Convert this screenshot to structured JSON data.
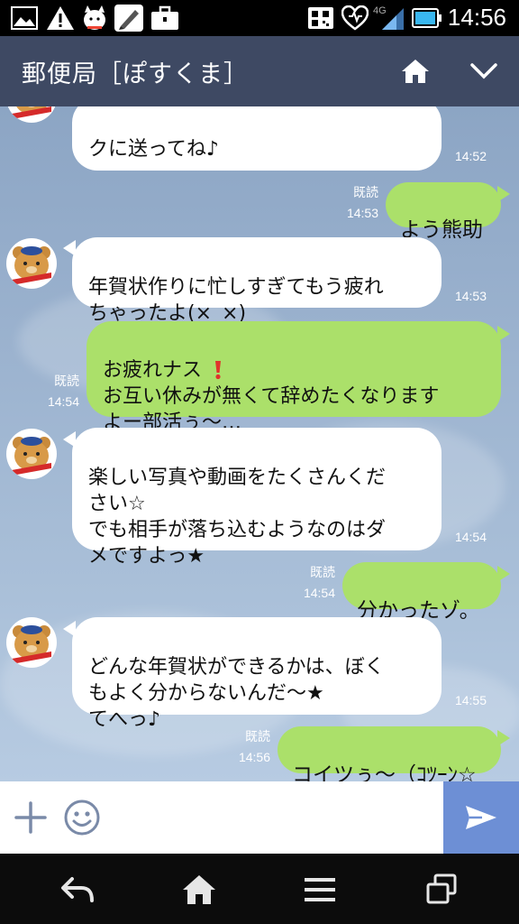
{
  "status_bar": {
    "time": "14:56",
    "network": "4G",
    "icons": [
      "image-icon",
      "warning-icon",
      "dog-icon",
      "pen-icon",
      "briefcase-icon",
      "qr-icon",
      "heart-icon",
      "signal-icon",
      "battery-icon"
    ]
  },
  "header": {
    "title": "郵便局［ぽすくま］",
    "icons": [
      "home-icon",
      "chevron-down-icon"
    ]
  },
  "messages": [
    {
      "side": "left",
      "text": "クに送ってね♪",
      "time": "14:52"
    },
    {
      "side": "right",
      "text": "よう熊助",
      "time": "14:53",
      "read": "既読"
    },
    {
      "side": "left",
      "text": "年賀状作りに忙しすぎてもう疲れ\nちゃったよ(×_×)",
      "time": "14:53"
    },
    {
      "side": "right",
      "text": "お疲れナス\nお互い休みが無くて辞めたくなります\nよー部活ぅ〜…",
      "time": "14:54",
      "read": "既読",
      "emoji": "exclamation-icon"
    },
    {
      "side": "left",
      "text": "楽しい写真や動画をたくさんくだ\nさい☆\nでも相手が落ち込むようなのはダ\nメですよっ★",
      "time": "14:54"
    },
    {
      "side": "right",
      "text": "分かったゾ。",
      "time": "14:54",
      "read": "既読"
    },
    {
      "side": "left",
      "text": "どんな年賀状ができるかは、ぼく\nもよく分からないんだ〜★\nてへっ♪",
      "time": "14:55"
    },
    {
      "side": "right",
      "text": "コイツぅ〜（ｺﾂｰﾝ☆",
      "time": "14:56",
      "read": "既読"
    }
  ],
  "input_bar": {
    "placeholder": "",
    "icons": [
      "plus-icon",
      "smiley-icon",
      "send-icon"
    ]
  },
  "nav_bar": {
    "icons": [
      "back-icon",
      "home-icon",
      "menu-icon",
      "recent-apps-icon"
    ]
  },
  "colors": {
    "header_bg": "#3e4963",
    "incoming_bubble": "#ffffff",
    "outgoing_bubble": "#abe06a",
    "send_button": "#6d8fd5",
    "chat_bg": "#9db4d0"
  }
}
